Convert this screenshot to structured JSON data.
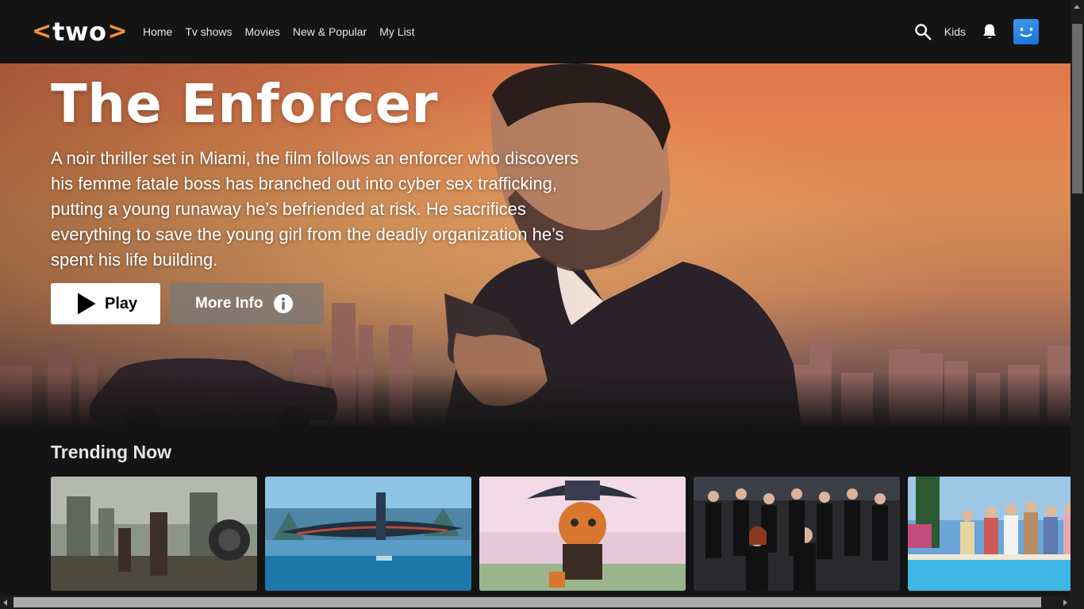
{
  "app": {
    "logo": {
      "open": "<",
      "word": "two",
      "close": ">"
    },
    "accent_color": "#f29135"
  },
  "nav": {
    "items": [
      "Home",
      "Tv shows",
      "Movies",
      "New & Popular",
      "My List"
    ],
    "kids_label": "Kids",
    "icons": [
      "search-icon",
      "bell-icon",
      "profile-avatar"
    ]
  },
  "hero": {
    "title": "The Enforcer",
    "description": "A noir thriller set in Miami, the film follows an enforcer who discovers his femme fatale boss has branched out into cyber sex trafficking, putting a young runaway he’s befriended at risk. He sacrifices everything to save the young girl from the deadly organization he’s spent his life building.",
    "play_label": "Play",
    "more_info_label": "More Info"
  },
  "trending": {
    "title": "Trending Now",
    "cards": [
      {
        "theme": "post-apocalyptic-city"
      },
      {
        "theme": "blue-creature-flight-ocean"
      },
      {
        "theme": "animated-cat-with-hat"
      },
      {
        "theme": "ensemble-cast-dark"
      },
      {
        "theme": "poolside-ensemble-cast"
      }
    ]
  }
}
